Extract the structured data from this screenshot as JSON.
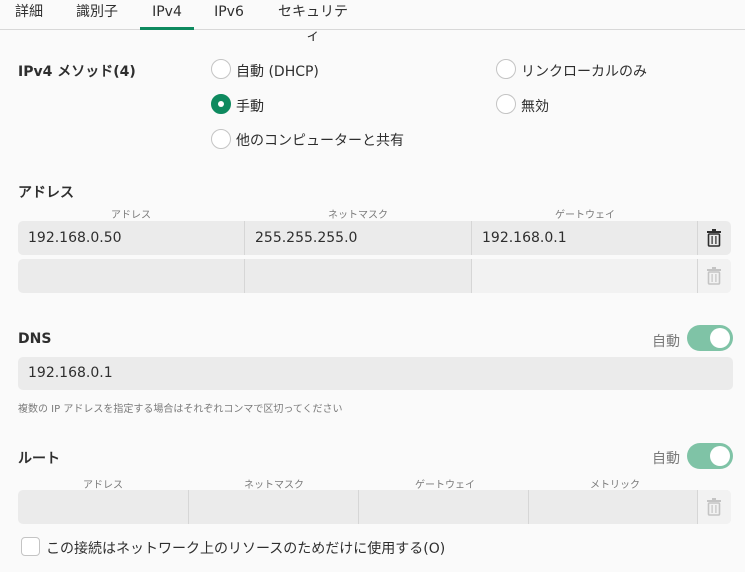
{
  "tabs": [
    {
      "label": "詳細"
    },
    {
      "label": "識別子"
    },
    {
      "label": "IPv4"
    },
    {
      "label": "IPv6"
    },
    {
      "label": "セキュリティ"
    }
  ],
  "active_tab": "IPv4",
  "method": {
    "title": "IPv4 メソッド(4)",
    "options": [
      {
        "label": "自動 (DHCP)",
        "checked": false
      },
      {
        "label": "手動",
        "checked": true
      },
      {
        "label": "他のコンピューターと共有",
        "checked": false
      },
      {
        "label": "リンクローカルのみ",
        "checked": false
      },
      {
        "label": "無効",
        "checked": false
      }
    ]
  },
  "address": {
    "title": "アドレス",
    "headers": [
      "アドレス",
      "ネットマスク",
      "ゲートウェイ"
    ],
    "rows": [
      [
        "192.168.0.50",
        "255.255.255.0",
        "192.168.0.1"
      ],
      [
        "",
        "",
        ""
      ]
    ]
  },
  "dns": {
    "title": "DNS",
    "auto_label": "自動",
    "auto_on": true,
    "value": "192.168.0.1",
    "hint": "複数の IP アドレスを指定する場合はそれぞれコンマで区切ってください"
  },
  "routes": {
    "title": "ルート",
    "auto_label": "自動",
    "auto_on": true,
    "headers": [
      "アドレス",
      "ネットマスク",
      "ゲートウェイ",
      "メトリック"
    ],
    "rows": [
      [
        "",
        "",
        "",
        ""
      ]
    ]
  },
  "only_local": {
    "label": "この接続はネットワーク上のリソースのためだけに使用する(O)",
    "checked": false
  },
  "colors": {
    "accent": "#0e8a5f",
    "toggle_on": "#7fc3a6"
  },
  "icons": {
    "delete": "trash-icon"
  }
}
